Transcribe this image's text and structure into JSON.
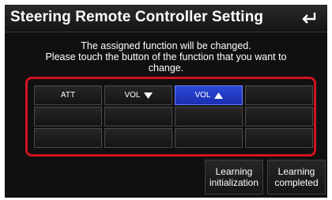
{
  "header": {
    "title": "Steering Remote Controller Setting",
    "back_icon": "back-arrow-icon"
  },
  "message": "The assigned function will be changed.\nPlease touch the button of the function that you want to\nchange.",
  "grid": {
    "cells": [
      {
        "label": "ATT",
        "icon": ""
      },
      {
        "label": "VOL",
        "icon": "triangle-down-icon"
      },
      {
        "label": "VOL",
        "icon": "triangle-up-icon",
        "selected": true
      },
      {
        "label": "",
        "icon": ""
      },
      {
        "label": "",
        "icon": ""
      },
      {
        "label": "",
        "icon": ""
      },
      {
        "label": "",
        "icon": ""
      },
      {
        "label": "",
        "icon": ""
      },
      {
        "label": "",
        "icon": ""
      },
      {
        "label": "",
        "icon": ""
      },
      {
        "label": "",
        "icon": ""
      },
      {
        "label": "",
        "icon": ""
      }
    ],
    "highlight_color": "#d0141e",
    "selected_color": "#2b49d6"
  },
  "buttons": {
    "learning_initialization": "Learning\ninitialization",
    "learning_completed": "Learning\ncompleted"
  }
}
